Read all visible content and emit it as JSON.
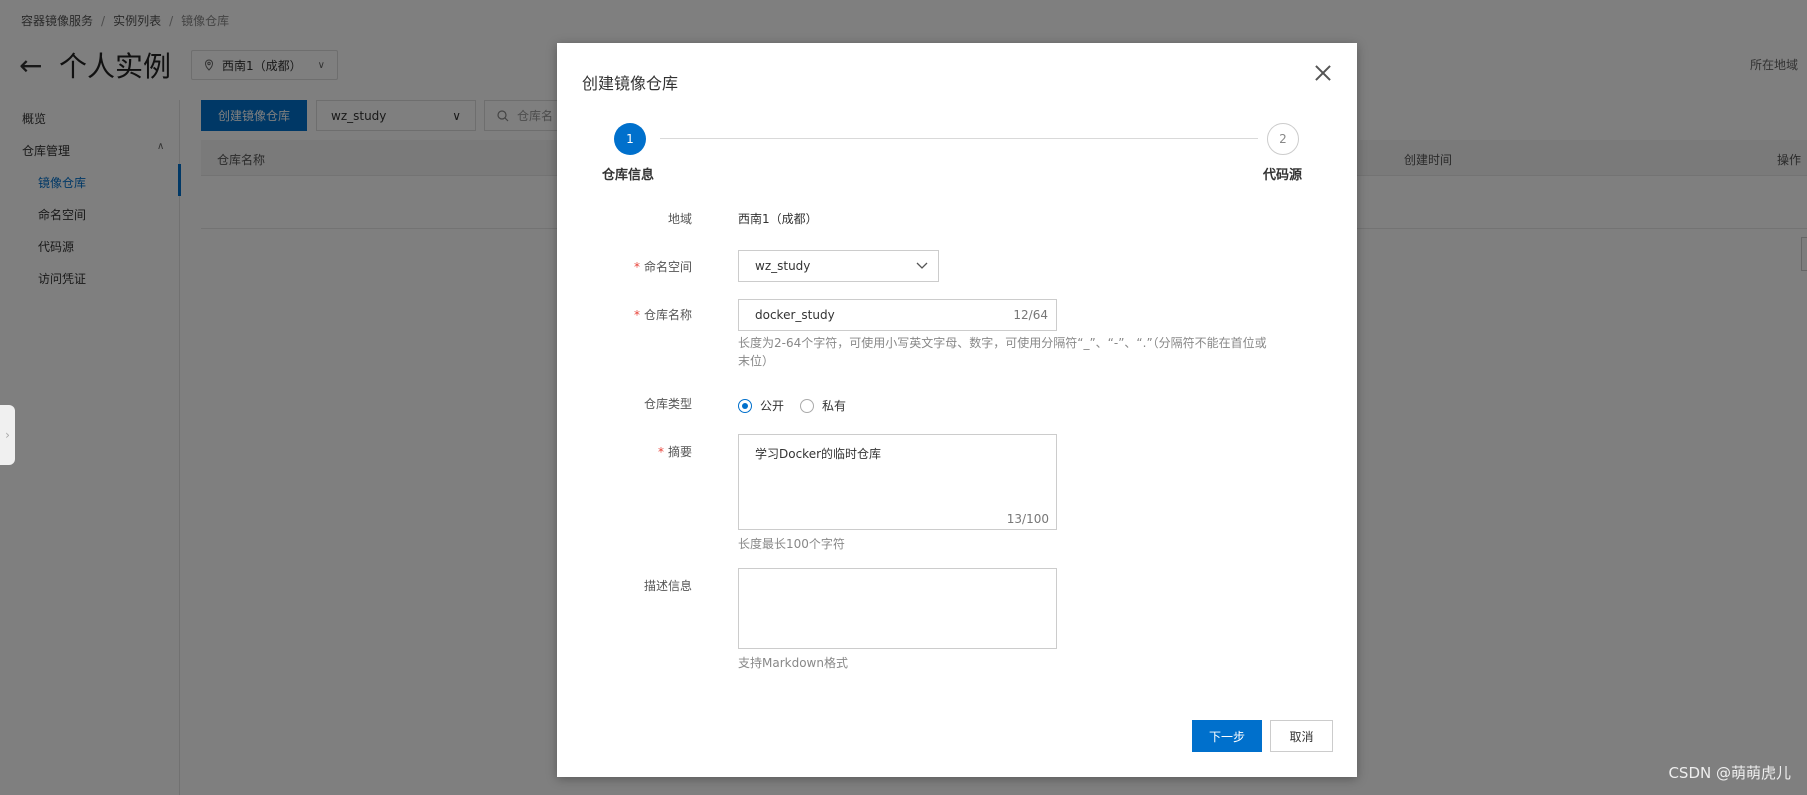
{
  "breadcrumb": [
    "容器镜像服务",
    "实例列表",
    "镜像仓库"
  ],
  "header": {
    "title": "个人实例",
    "region": "西南1（成都）",
    "right_label": "所在地域"
  },
  "sidebar": {
    "items": [
      {
        "label": "概览"
      },
      {
        "label": "仓库管理"
      },
      {
        "label": "镜像仓库"
      },
      {
        "label": "命名空间"
      },
      {
        "label": "代码源"
      },
      {
        "label": "访问凭证"
      }
    ]
  },
  "toolbar": {
    "create_label": "创建镜像仓库",
    "namespace_value": "wz_study",
    "search_placeholder": "仓库名"
  },
  "table": {
    "columns": {
      "name": "仓库名称",
      "created": "创建时间",
      "ops": "操作"
    }
  },
  "dialog": {
    "title": "创建镜像仓库",
    "steps": [
      {
        "num": "1",
        "label": "仓库信息"
      },
      {
        "num": "2",
        "label": "代码源"
      }
    ],
    "form": {
      "region_label": "地域",
      "region_value": "西南1（成都）",
      "namespace_label": "命名空间",
      "namespace_value": "wz_study",
      "repo_name_label": "仓库名称",
      "repo_name_value": "docker_study",
      "repo_name_counter": "12/64",
      "repo_name_hint_1": "长度为2-64个字符，可使用小写英文字母、数字，可使用分隔符“_”、“-”、“.”（分隔符不能在首位或",
      "repo_name_hint_2": "末位）",
      "repo_type_label": "仓库类型",
      "repo_type_public": "公开",
      "repo_type_private": "私有",
      "summary_label": "摘要",
      "summary_value": "学习Docker的临时仓库",
      "summary_counter": "13/100",
      "summary_hint": "长度最长100个字符",
      "desc_label": "描述信息",
      "desc_value": "",
      "desc_hint": "支持Markdown格式"
    },
    "buttons": {
      "next": "下一步",
      "cancel": "取消"
    }
  },
  "watermark": "CSDN @萌萌虎儿"
}
